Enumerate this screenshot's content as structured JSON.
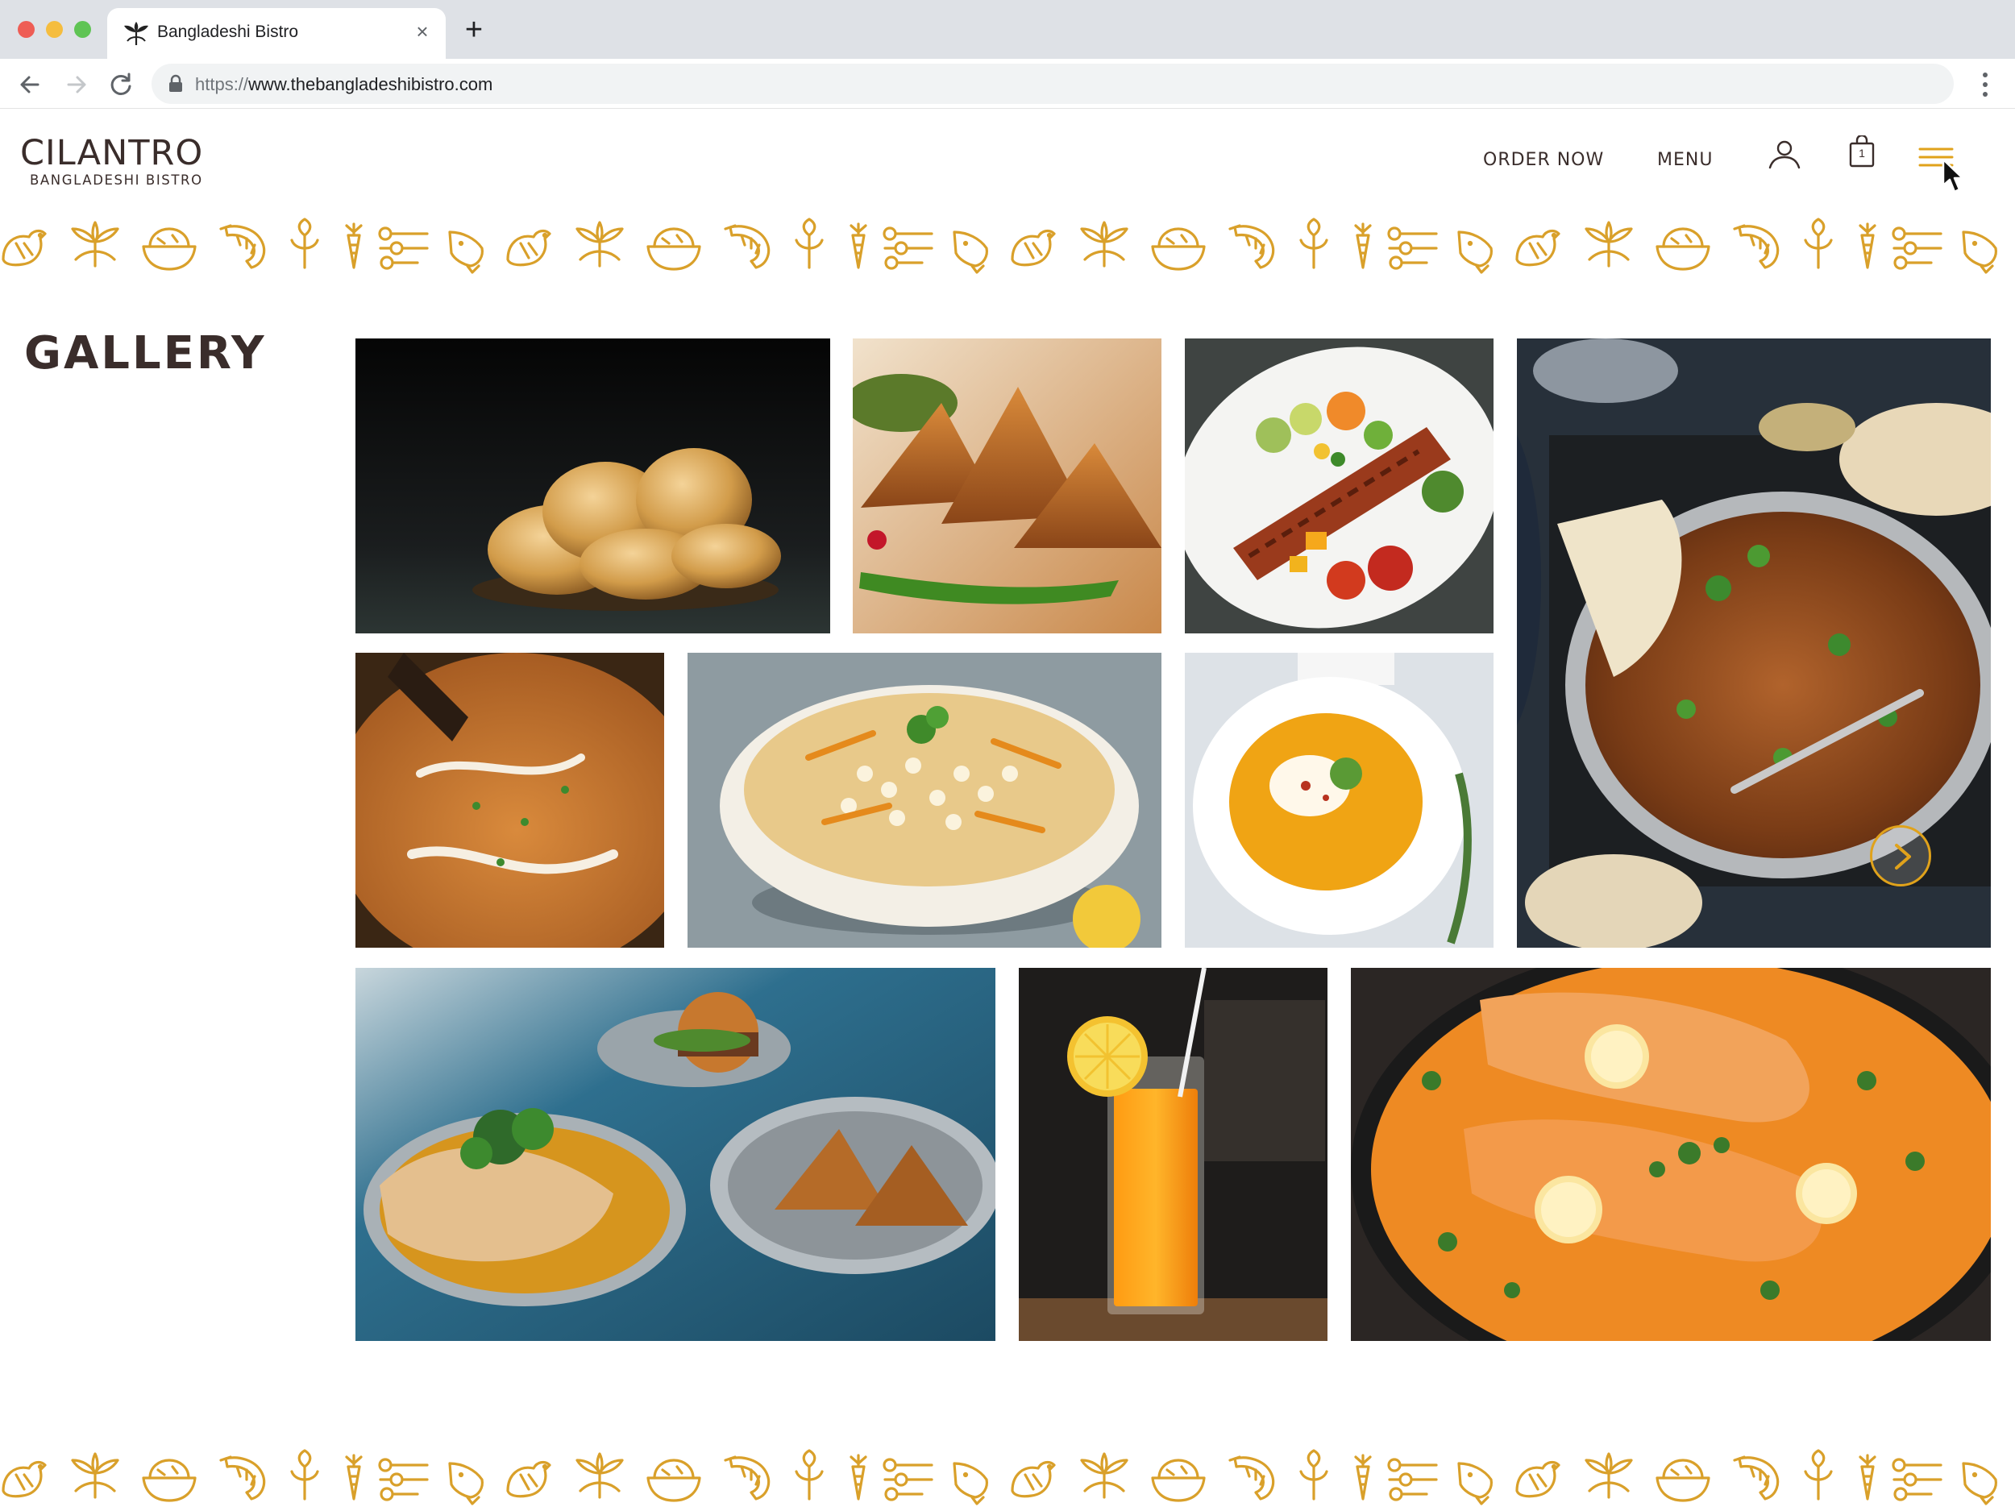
{
  "browser": {
    "tab_title": "Bangladeshi Bistro",
    "tab_close": "×",
    "new_tab": "+",
    "url_scheme": "https://",
    "url_host": "www.thebangladeshibistro.com"
  },
  "header": {
    "logo_main": "CILANTRO",
    "logo_sub": "BANGLADESHI BISTRO",
    "nav": {
      "order_now": "ORDER NOW",
      "menu": "MENU"
    },
    "cart_count": "1",
    "icons": [
      "account-icon",
      "cart-icon",
      "hamburger-menu-icon"
    ]
  },
  "gallery": {
    "title": "GALLERY",
    "photos": [
      "puri-fried-bread",
      "samosas-with-chili",
      "grilled-kebab-platter",
      "chicken-curry-pan-with-naan",
      "butter-chicken",
      "sabudana-khichdi-bowl",
      "lentil-soup",
      "paratha-and-samosa-plates",
      "orange-juice-glass",
      "salmon-curry-skillet"
    ],
    "next_button_icon": "chevron-right-icon"
  },
  "colors": {
    "brand_dark": "#3a2d2b",
    "accent_gold": "#e0a21b",
    "pattern_gold": "#d9a02a"
  },
  "pattern_icons": [
    "chicken",
    "herb",
    "bowl",
    "shrimp",
    "sprout",
    "carrot",
    "spices",
    "fish"
  ]
}
